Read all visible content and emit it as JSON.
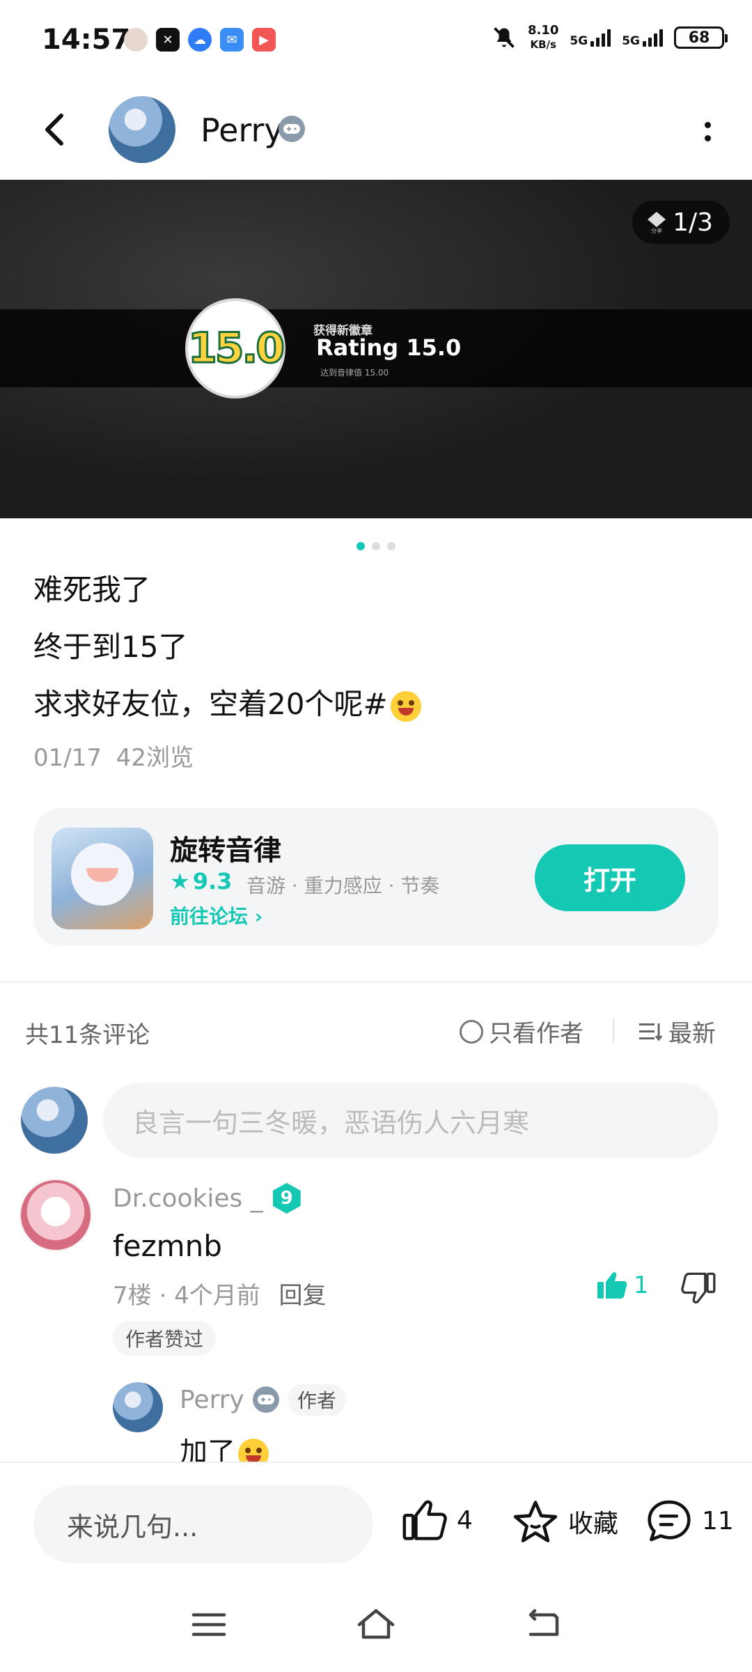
{
  "status_bar": {
    "time": "14:57",
    "speed": "8.10",
    "speed_unit": "KB/s",
    "net1": "5G",
    "net2": "5G",
    "battery": "68"
  },
  "header": {
    "username": "Perry",
    "badge_icon": "gamepad-icon"
  },
  "banner": {
    "medal_text": "15.0",
    "sub_label": "获得新徽章",
    "title": "Rating 15.0",
    "hint": "达到音律值 15.00",
    "page_indicator": "1/3",
    "share_label": "分享"
  },
  "post": {
    "lines": [
      "难死我了",
      "终于到15了",
      "求求好友位，空着20个呢#"
    ],
    "date": "01/17",
    "views": "42浏览"
  },
  "app_card": {
    "name": "旋转音律",
    "rating": "9.3",
    "tags": "音游 · 重力感应 · 节奏",
    "forum_link": "前往论坛",
    "open_label": "打开"
  },
  "comments": {
    "count_label": "共11条评论",
    "only_author_label": "只看作者",
    "sort_label": "最新",
    "input_placeholder": "良言一句三冬暖，恶语伤人六月寒",
    "items": [
      {
        "user": "Dr.cookies _",
        "level": "9",
        "text": "fezmnb",
        "floor": "7楼",
        "time": "4个月前",
        "reply_label": "回复",
        "likes": "1",
        "author_liked_label": "作者赞过",
        "reply": {
          "user": "Perry",
          "author_tag": "作者",
          "text": "加了"
        }
      }
    ]
  },
  "bottom_bar": {
    "input_placeholder": "来说几句...",
    "like_count": "4",
    "favorite_label": "收藏",
    "comment_count": "11"
  },
  "colors": {
    "accent": "#14c8b4",
    "muted_text": "#999999",
    "input_bg": "#f3f5f7"
  }
}
